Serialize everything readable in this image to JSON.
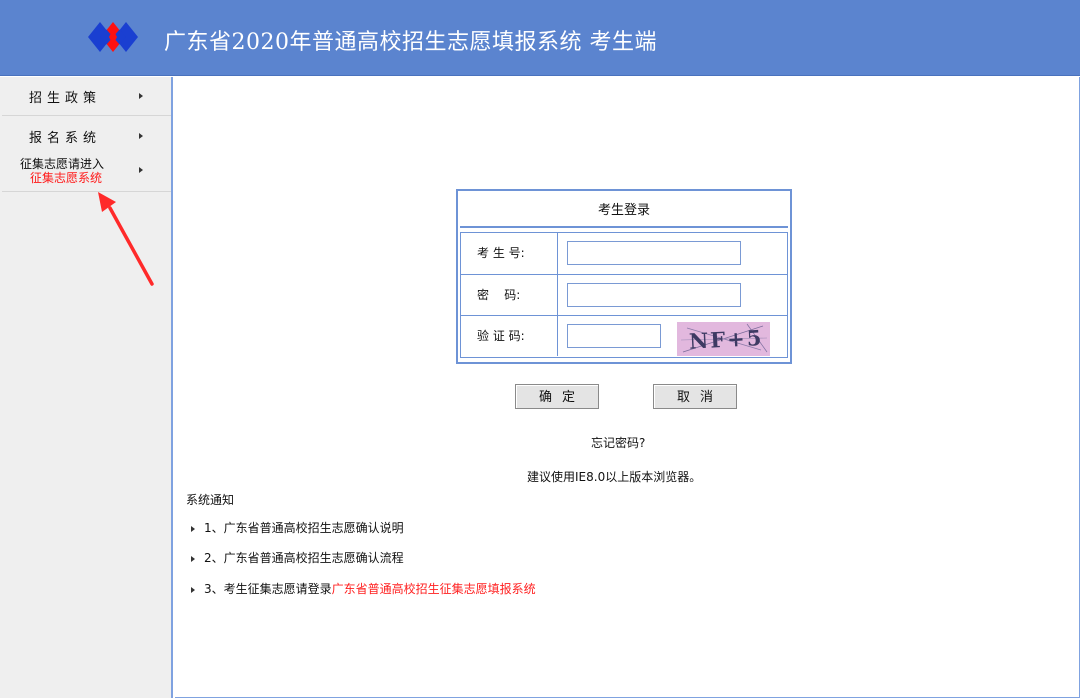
{
  "header": {
    "title": "广东省2020年普通高校招生志愿填报系统 考生端",
    "colors": {
      "background": "#5b84cf",
      "logo_blue": "#1a3fd1",
      "logo_red": "#ff1111"
    },
    "logo_icon": "diamond-logo-icon"
  },
  "sidebar": {
    "items": [
      {
        "label": "招生政策"
      },
      {
        "label": "报名系统"
      },
      {
        "line1": "征集志愿请进入",
        "line2": "征集志愿系统"
      }
    ]
  },
  "login": {
    "title": "考生登录",
    "fields": [
      {
        "label": "考 生 号:",
        "value": ""
      },
      {
        "label": "密    码:",
        "value": ""
      },
      {
        "label": "验 证 码:",
        "value": ""
      }
    ],
    "captcha_text": "NF+5",
    "ok_label": "确定",
    "cancel_label": "取消",
    "forgot": "忘记密码?",
    "browser_tip": "建议使用IE8.0以上版本浏览器。"
  },
  "notices": {
    "title": "系统通知",
    "items": [
      {
        "text": "1、广东省普通高校招生志愿确认说明"
      },
      {
        "text": "2、广东省普通高校招生志愿确认流程"
      },
      {
        "text": "3、考生征集志愿请登录",
        "link": "广东省普通高校招生征集志愿填报系统"
      }
    ]
  }
}
